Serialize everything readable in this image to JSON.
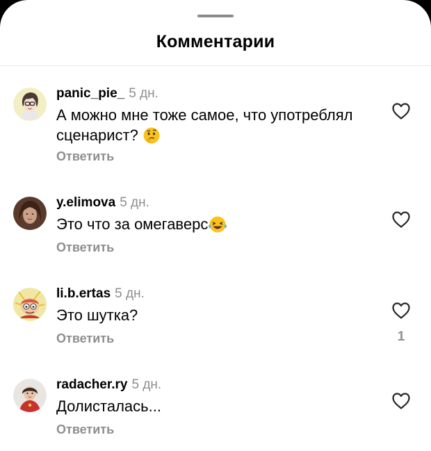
{
  "header": {
    "title": "Комментарии"
  },
  "comments": [
    {
      "username": "panic_pie_",
      "time": "5 дн.",
      "text": "А можно мне тоже самое, что употреблял сценарист?",
      "emoji": "thinking-face-emoji",
      "reply_label": "Ответить",
      "like_icon": "heart-outline-icon",
      "likes": ""
    },
    {
      "username": "y.elimova",
      "time": "5 дн.",
      "text": "Это что за омегаверс",
      "emoji": "laughing-tears-emoji",
      "reply_label": "Ответить",
      "like_icon": "heart-outline-icon",
      "likes": ""
    },
    {
      "username": "li.b.ertas",
      "time": "5 дн.",
      "text": "Это шутка?",
      "emoji": "",
      "reply_label": "Ответить",
      "like_icon": "heart-outline-icon",
      "likes": "1"
    },
    {
      "username": "radacher.ry",
      "time": "5 дн.",
      "text": "Долисталась...",
      "emoji": "",
      "reply_label": "Ответить",
      "like_icon": "heart-outline-icon",
      "likes": ""
    }
  ],
  "colors": {
    "background": "#ffffff",
    "secondary_text": "#8e8e8e",
    "primary_text": "#000000",
    "divider": "#e6e6e6",
    "grabber": "#8a8a8e"
  }
}
